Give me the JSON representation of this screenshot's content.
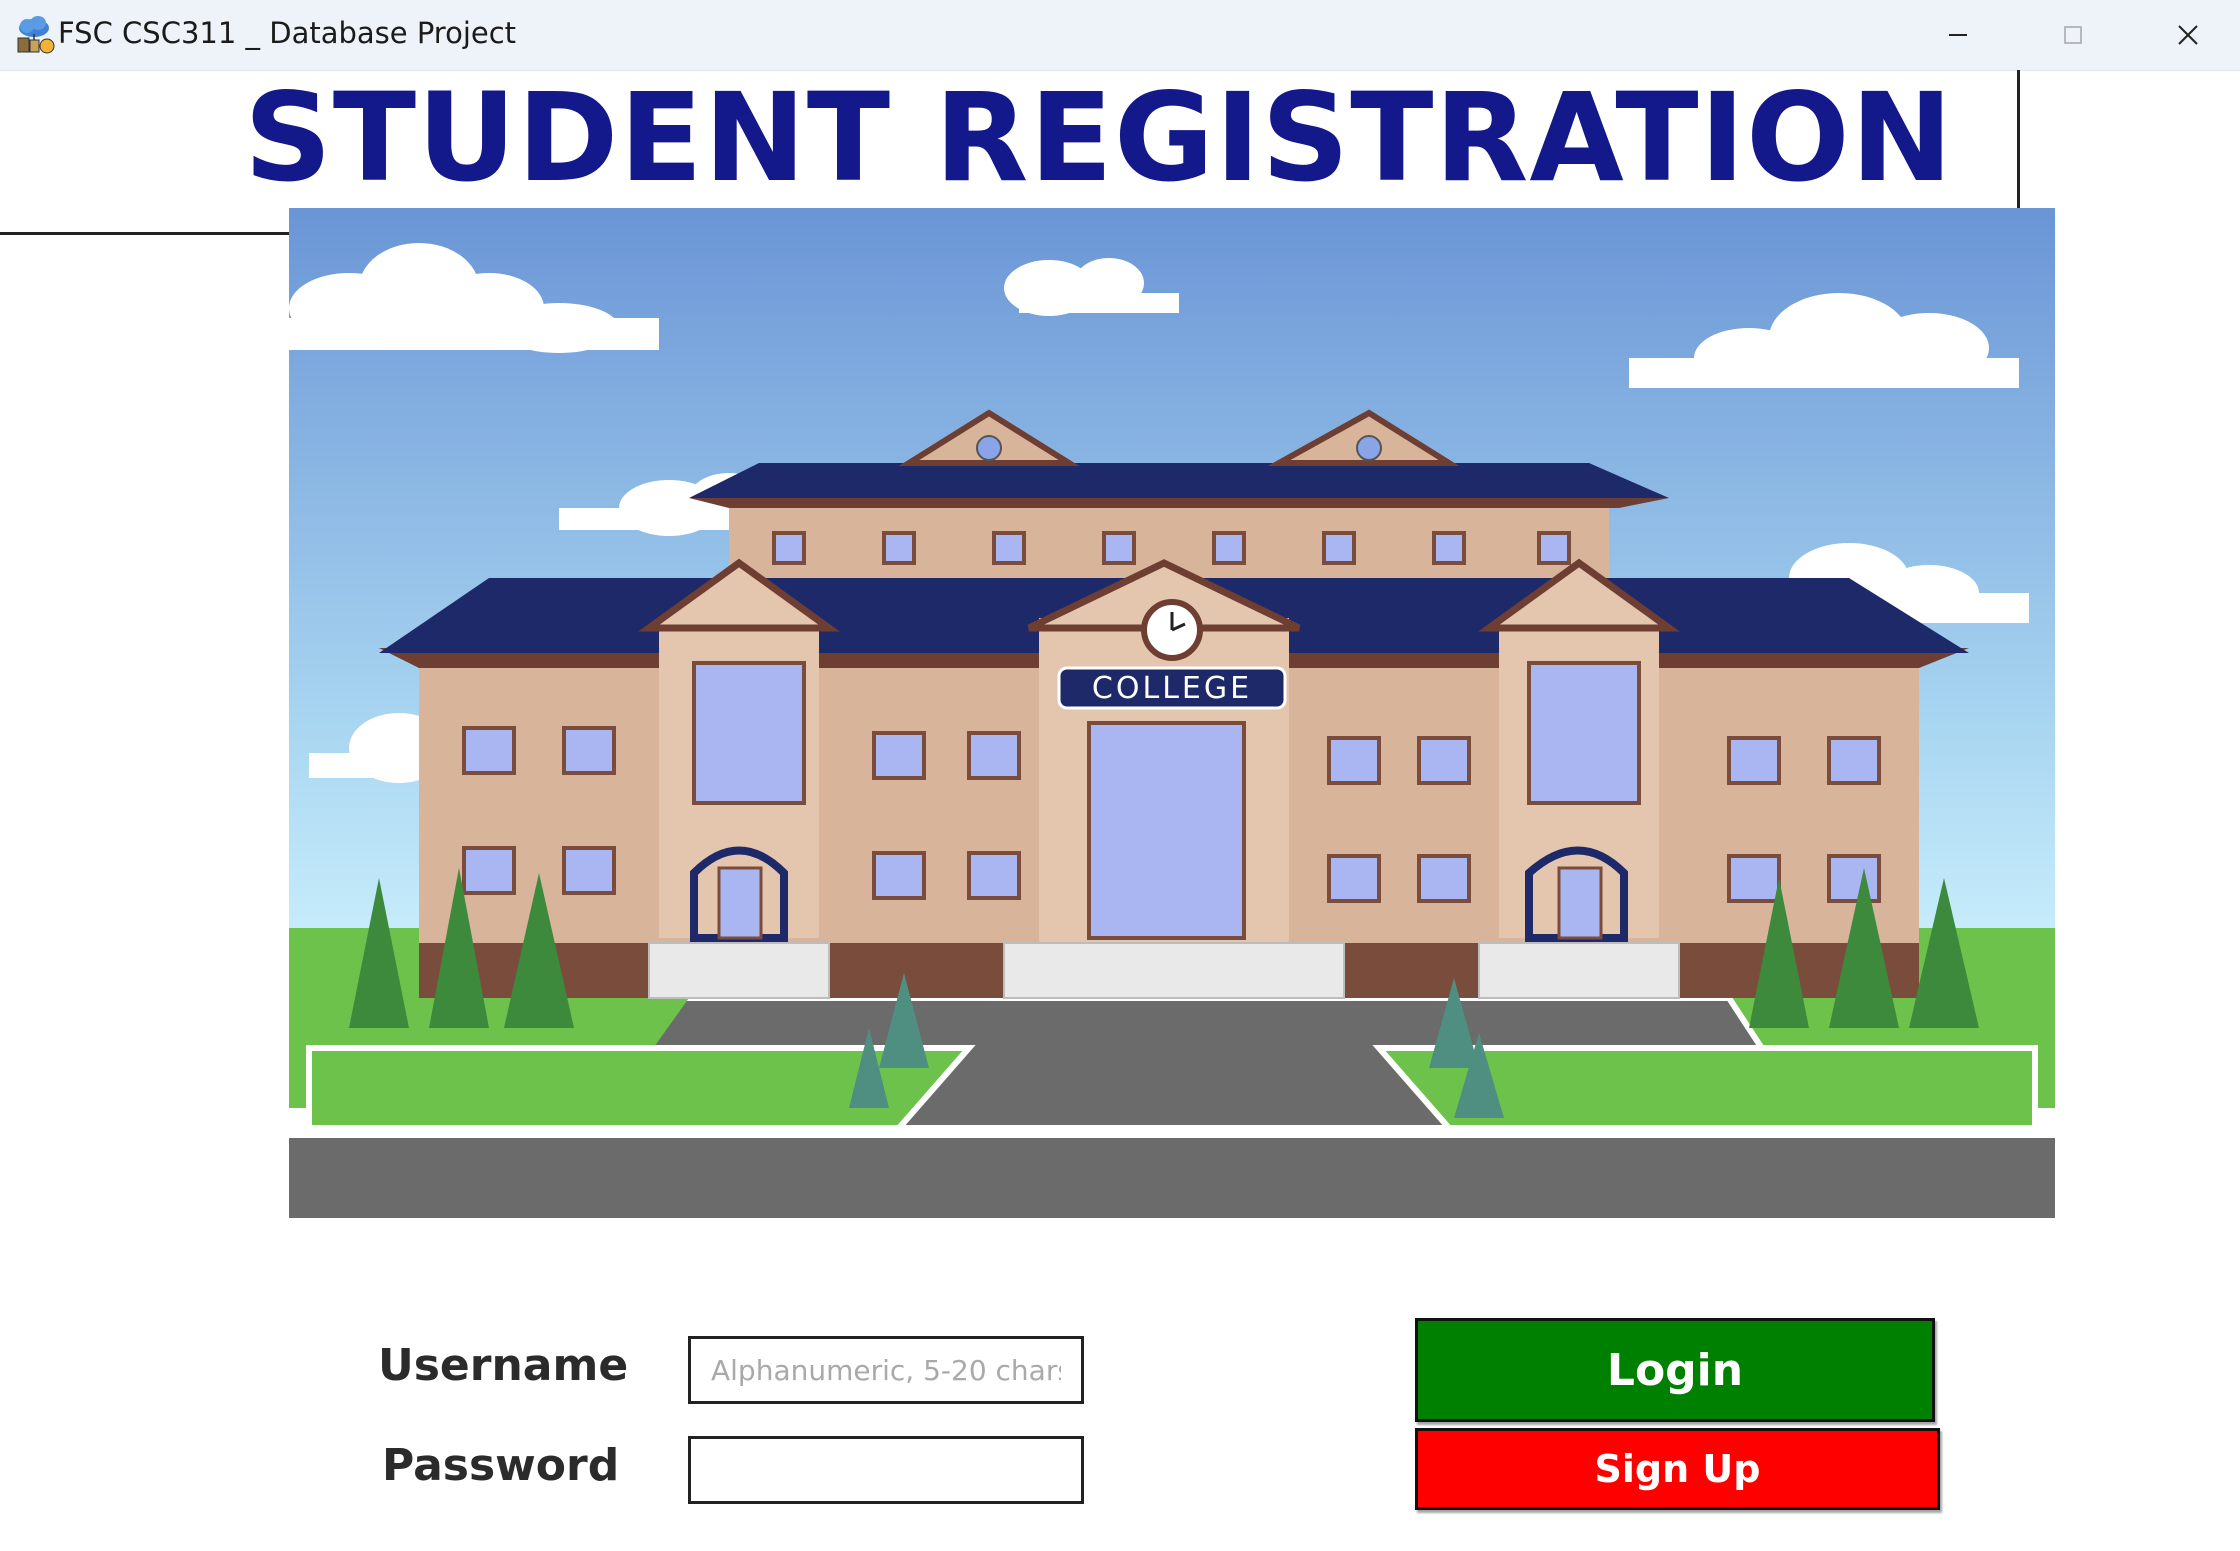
{
  "window": {
    "title": "FSC CSC311 _ Database Project",
    "icon": "cloud-database-icon",
    "controls": [
      "minimize-icon",
      "maximize-icon",
      "close-icon"
    ]
  },
  "header": {
    "title": "STUDENT REGISTRATION",
    "color": "#13188a"
  },
  "illustration": {
    "subject": "college-building",
    "sign_text": "COLLEGE"
  },
  "form": {
    "username_label": "Username",
    "username_placeholder": "Alphanumeric, 5-20 chars",
    "username_value": "",
    "password_label": "Password",
    "password_value": ""
  },
  "actions": {
    "login_label": "Login",
    "login_color": "#008000",
    "signup_label": "Sign Up",
    "signup_color": "#ff0000"
  }
}
